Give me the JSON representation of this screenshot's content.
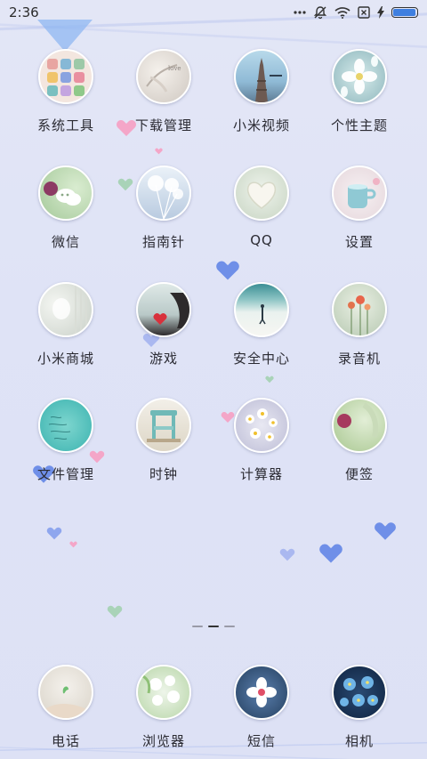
{
  "status_bar": {
    "time": "2:36",
    "icons": [
      "more-dots-icon",
      "bell-off-icon",
      "wifi-icon",
      "sim-x-icon",
      "charging-bolt-icon",
      "battery-icon"
    ],
    "battery_level": 0.95
  },
  "apps": [
    {
      "name": "系统工具",
      "icon": "tools-folder-icon"
    },
    {
      "name": "下载管理",
      "icon": "download-icon"
    },
    {
      "name": "小米视频",
      "icon": "video-icon"
    },
    {
      "name": "个性主题",
      "icon": "theme-icon"
    },
    {
      "name": "微信",
      "icon": "wechat-icon"
    },
    {
      "name": "指南针",
      "icon": "compass-icon"
    },
    {
      "name": "QQ",
      "icon": "qq-icon"
    },
    {
      "name": "设置",
      "icon": "settings-icon"
    },
    {
      "name": "小米商城",
      "icon": "mi-store-icon"
    },
    {
      "name": "游戏",
      "icon": "games-icon"
    },
    {
      "name": "安全中心",
      "icon": "security-icon"
    },
    {
      "name": "录音机",
      "icon": "recorder-icon"
    },
    {
      "name": "文件管理",
      "icon": "file-manager-icon"
    },
    {
      "name": "时钟",
      "icon": "clock-icon"
    },
    {
      "name": "计算器",
      "icon": "calculator-icon"
    },
    {
      "name": "便签",
      "icon": "notes-icon"
    }
  ],
  "dock": [
    {
      "name": "电话",
      "icon": "phone-icon"
    },
    {
      "name": "浏览器",
      "icon": "browser-icon"
    },
    {
      "name": "短信",
      "icon": "messages-icon"
    },
    {
      "name": "相机",
      "icon": "camera-icon"
    }
  ],
  "page_indicator": {
    "pages": 3,
    "current": 2
  }
}
